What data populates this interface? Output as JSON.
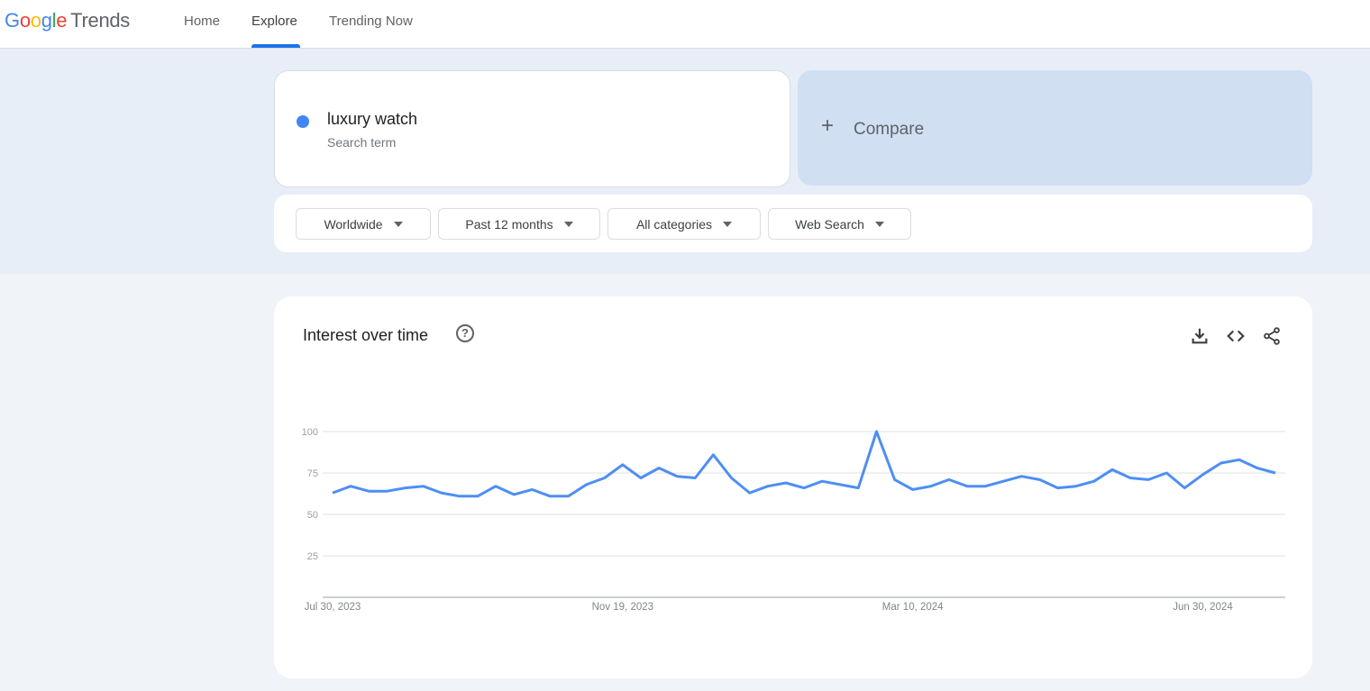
{
  "header": {
    "logo_letters": [
      "G",
      "o",
      "o",
      "g",
      "l",
      "e"
    ],
    "logo_product": "Trends",
    "nav": [
      {
        "label": "Home",
        "active": false
      },
      {
        "label": "Explore",
        "active": true
      },
      {
        "label": "Trending Now",
        "active": false
      }
    ]
  },
  "search": {
    "term": "luxury watch",
    "term_type": "Search term",
    "term_color": "#4285f4",
    "compare_label": "Compare",
    "compare_icon": "plus-icon"
  },
  "filters": [
    {
      "label": "Worldwide"
    },
    {
      "label": "Past 12 months"
    },
    {
      "label": "All categories"
    },
    {
      "label": "Web Search"
    }
  ],
  "interest_panel": {
    "title": "Interest over time",
    "help_icon": "help-icon",
    "actions": [
      "download-icon",
      "embed-code-icon",
      "share-icon"
    ]
  },
  "chart_data": {
    "type": "line",
    "title": "Interest over time",
    "xlabel": "",
    "ylabel": "",
    "ylim": [
      0,
      100
    ],
    "yticks": [
      25,
      50,
      75,
      100
    ],
    "grid": true,
    "x_tick_labels": [
      {
        "index": 0,
        "label": "Jul 30, 2023"
      },
      {
        "index": 16,
        "label": "Nov 19, 2023"
      },
      {
        "index": 32,
        "label": "Mar 10, 2024"
      },
      {
        "index": 48,
        "label": "Jun 30, 2024"
      }
    ],
    "series": [
      {
        "name": "luxury watch",
        "color": "#4e8ef4",
        "values": [
          63,
          67,
          64,
          64,
          66,
          67,
          63,
          61,
          61,
          67,
          62,
          65,
          61,
          61,
          68,
          72,
          80,
          72,
          78,
          73,
          72,
          86,
          72,
          63,
          67,
          69,
          66,
          70,
          68,
          66,
          100,
          71,
          65,
          67,
          71,
          67,
          67,
          70,
          73,
          71,
          66,
          67,
          70,
          77,
          72,
          71,
          75,
          66,
          74,
          81,
          83,
          78,
          75
        ]
      }
    ]
  }
}
